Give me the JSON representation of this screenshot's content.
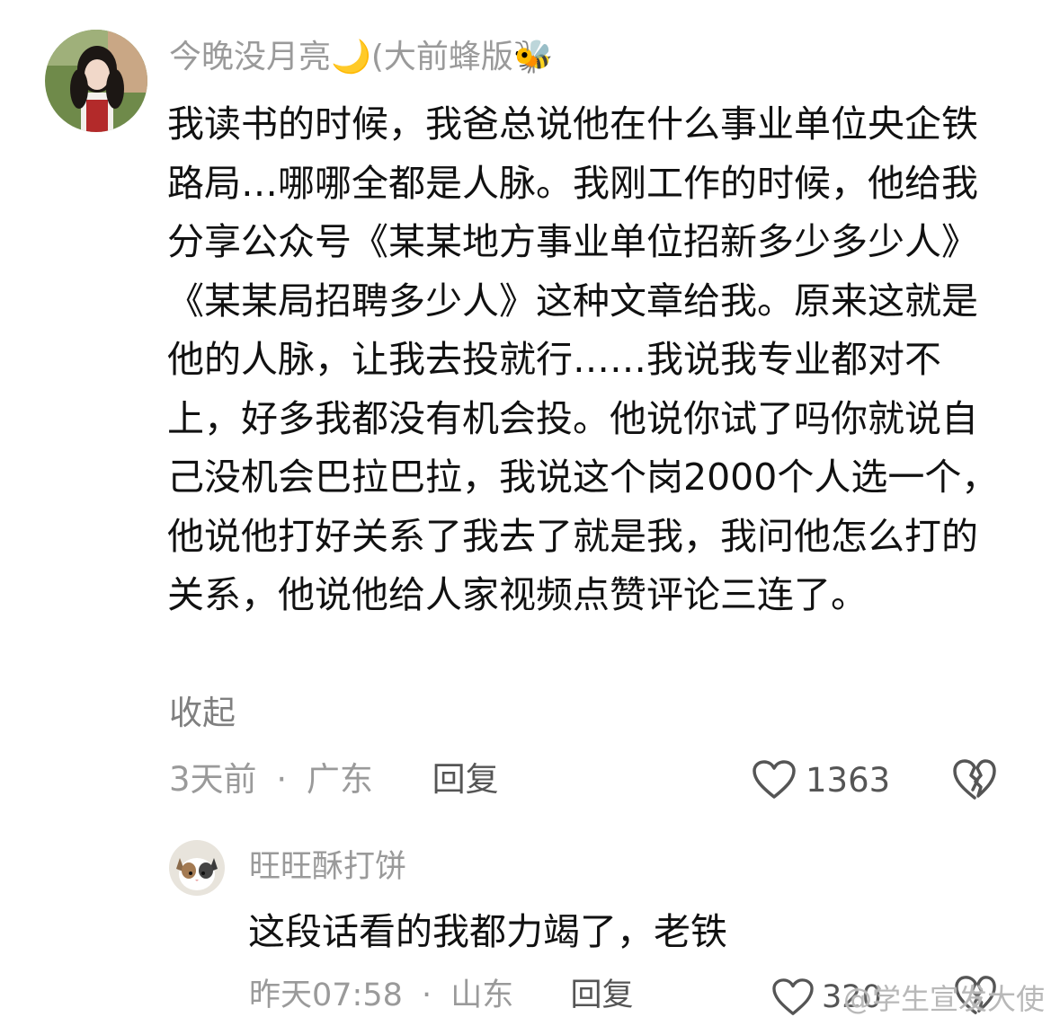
{
  "main_comment": {
    "username": "今晚没月亮🌙(大前蜂版🐝",
    "body": "我读书的时候，我爸总说他在什么事业单位央企铁路局…哪哪全都是人脉。我刚工作的时候，他给我分享公众号《某某地方事业单位招新多少多少人》《某某局招聘多少人》这种文章给我。原来这就是他的人脉，让我去投就行……我说我专业都对不上，好多我都没有机会投。他说你试了吗你就说自己没机会巴拉巴拉，我说这个岗2000个人选一个，他说他打好关系了我去了就是我，我问他怎么打的关系，他说他给人家视频点赞评论三连了。",
    "collapse_label": "收起",
    "time": "3天前",
    "separator": "·",
    "location": "广东",
    "reply_label": "回复",
    "likes": "1363",
    "like_icon": "heart-outline-icon",
    "dislike_icon": "broken-heart-icon"
  },
  "reply_comment": {
    "username": "旺旺酥打饼",
    "body": "这段话看的我都力竭了，老铁",
    "time": "昨天07:58",
    "separator": "·",
    "location": "山东",
    "reply_label": "回复",
    "likes": "320",
    "like_icon": "heart-outline-icon",
    "dislike_icon": "broken-heart-icon"
  },
  "watermark": "@学生宣发大使",
  "colors": {
    "text_primary": "#111111",
    "text_secondary": "#9a9a9a",
    "icon": "#555555",
    "background": "#ffffff"
  }
}
